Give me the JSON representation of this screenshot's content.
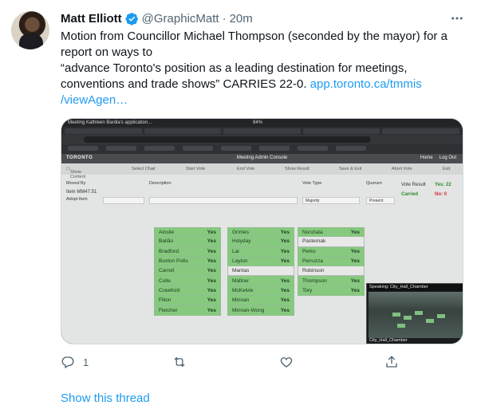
{
  "author": {
    "name": "Matt Elliott",
    "handle": "@GraphicMatt",
    "separator": "·",
    "time": "20m"
  },
  "tweet": {
    "line1": "Motion from Councillor Michael Thompson (seconded by the mayor) for a",
    "line2": "report on ways to",
    "line3": "“advance Toronto's position as a leading destination for meetings,",
    "line4_text": "conventions and trade shows” CARRIES 22-0. ",
    "line4_link": "app.toronto.ca/tmmis",
    "line5_link": "/viewAgen…"
  },
  "screenshot": {
    "tab_title": "Meeting Kathleen Bardia's application...",
    "zoom": "84%",
    "app_logo": "TORONTO",
    "app_title": "Meeting Admin Console",
    "nav": {
      "home": "Home",
      "logout": "Log Out"
    },
    "toolbar": {
      "show_content": "Show Content",
      "select_chair": "Select Chair",
      "start_vote": "Start Vote",
      "end_vote": "End Vote",
      "show_result": "Show Result",
      "save_exit": "Save & Exit",
      "abort_vote": "Abort Vote",
      "exit": "Exit"
    },
    "fields": {
      "item": "Item MM47.51",
      "adopt": "Adopt Item",
      "moved_by": "Moved By",
      "description": "Description",
      "vote_type": "Vote Type",
      "vote_type_value": "Majority",
      "quorum": "Quorum",
      "quorum_value": "Present",
      "vote_result": "Vote Result",
      "carried": "Carried",
      "yes_count": "Yes: 22",
      "no_count": "No: 0"
    },
    "columns": [
      [
        {
          "name": "Ainslie",
          "vote": "Yes"
        },
        {
          "name": "Bailão",
          "vote": "Yes"
        },
        {
          "name": "Bradford",
          "vote": "Yes"
        },
        {
          "name": "Buxton Potts",
          "vote": "Yes"
        },
        {
          "name": "Carroll",
          "vote": "Yes"
        },
        {
          "name": "Colle",
          "vote": "Yes"
        },
        {
          "name": "Crawford",
          "vote": "Yes"
        },
        {
          "name": "Filion",
          "vote": "Yes"
        },
        {
          "name": "Fletcher",
          "vote": "Yes"
        }
      ],
      [
        {
          "name": "Grimes",
          "vote": "Yes"
        },
        {
          "name": "Holyday",
          "vote": "Yes"
        },
        {
          "name": "Lai",
          "vote": "Yes"
        },
        {
          "name": "Layton",
          "vote": "Yes"
        },
        {
          "name": "Mantas",
          "vote": ""
        },
        {
          "name": "Matlow",
          "vote": "Yes"
        },
        {
          "name": "McKelvie",
          "vote": "Yes"
        },
        {
          "name": "Minnan",
          "vote": "Yes"
        },
        {
          "name": "Minnan-Wong",
          "vote": "Yes"
        }
      ],
      [
        {
          "name": "Nunziata",
          "vote": "Yes"
        },
        {
          "name": "Pasternak",
          "vote": ""
        },
        {
          "name": "Perks",
          "vote": "Yes"
        },
        {
          "name": "Perruzza",
          "vote": "Yes"
        },
        {
          "name": "Robinson",
          "vote": ""
        },
        {
          "name": "Thompson",
          "vote": "Yes"
        },
        {
          "name": "Tory",
          "vote": "Yes"
        }
      ]
    ],
    "pip_label": "Speaking: City_Hall_Chamber",
    "pip_bottom": "City_Hall_Chamber"
  },
  "actions": {
    "reply_count": "1"
  },
  "show_thread": "Show this thread",
  "colors": {
    "link": "#1d9bf0",
    "muted": "#536471",
    "yes_cell": "#86c97f"
  }
}
